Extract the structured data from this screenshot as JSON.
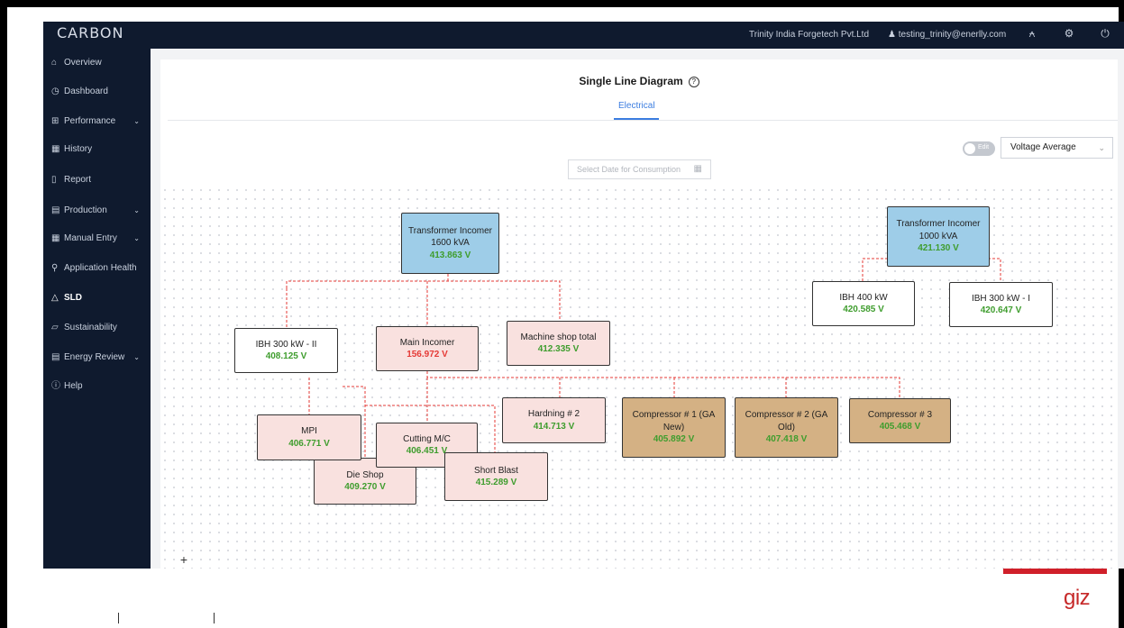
{
  "topbar": {
    "logo": "CARBON",
    "company": "Trinity India Forgetech Pvt.Ltd",
    "user": "testing_trinity@enerlly.com",
    "icons": [
      "bell-icon",
      "gear-icon",
      "power-icon"
    ]
  },
  "sidebar": {
    "items": [
      {
        "label": "Overview",
        "icon": "home-icon",
        "chevron": false
      },
      {
        "label": "Dashboard",
        "icon": "clock-icon",
        "chevron": false
      },
      {
        "label": "Performance",
        "icon": "grid-icon",
        "chevron": true
      },
      {
        "label": "History",
        "icon": "calendar-icon",
        "chevron": false
      },
      {
        "label": "Report",
        "icon": "document-icon",
        "chevron": false
      },
      {
        "label": "Production",
        "icon": "list-icon",
        "chevron": true
      },
      {
        "label": "Manual Entry",
        "icon": "table-icon",
        "chevron": true
      },
      {
        "label": "Application Health",
        "icon": "pin-icon",
        "chevron": false
      },
      {
        "label": "SLD",
        "icon": "tree-icon",
        "chevron": false,
        "active": true
      },
      {
        "label": "Sustainability",
        "icon": "chart-icon",
        "chevron": false
      },
      {
        "label": "Energy Review",
        "icon": "list-icon",
        "chevron": true
      },
      {
        "label": "Help",
        "icon": "help-icon",
        "chevron": false
      }
    ]
  },
  "main": {
    "title": "Single Line Diagram",
    "tab": "Electrical",
    "toggle_label": "Edit",
    "select_value": "Voltage Average",
    "date_placeholder": "Select Date for Consumption"
  },
  "nodes": {
    "tr1600": {
      "name": "Transformer Incomer",
      "sub": "1600 kVA",
      "value": "413.863 V"
    },
    "tr1000": {
      "name": "Transformer Incomer",
      "sub": "1000 kVA",
      "value": "421.130 V"
    },
    "ibh300ii": {
      "name": "IBH 300 kW - II",
      "value": "408.125 V"
    },
    "main_incomer": {
      "name": "Main Incomer",
      "value": "156.972 V"
    },
    "machine_shop": {
      "name": "Machine shop total",
      "value": "412.335 V"
    },
    "ibh400": {
      "name": "IBH 400 kW",
      "value": "420.585 V"
    },
    "ibh300i": {
      "name": "IBH 300 kW - I",
      "value": "420.647 V"
    },
    "mpi": {
      "name": "MPI",
      "value": "406.771 V"
    },
    "cutting": {
      "name": "Cutting M/C",
      "value": "406.451 V"
    },
    "die_shop": {
      "name": "Die Shop",
      "value": "409.270 V"
    },
    "short_blast": {
      "name": "Short Blast",
      "value": "415.289 V"
    },
    "hardning2": {
      "name": "Hardning # 2",
      "value": "414.713 V"
    },
    "comp1": {
      "name": "Compressor # 1 (GA New)",
      "value": "405.892 V"
    },
    "comp2": {
      "name": "Compressor # 2 (GA Old)",
      "value": "407.418 V"
    },
    "comp3": {
      "name": "Compressor # 3",
      "value": "405.468 V"
    }
  },
  "footer": {
    "brand": "giz",
    "brand_color": "#d0202a"
  },
  "colors": {
    "sidebar": "#0f1a2e",
    "accent": "#3b7de0",
    "value_green": "#3f9d2e",
    "value_red": "#e53935",
    "line_red": "#e53935"
  }
}
